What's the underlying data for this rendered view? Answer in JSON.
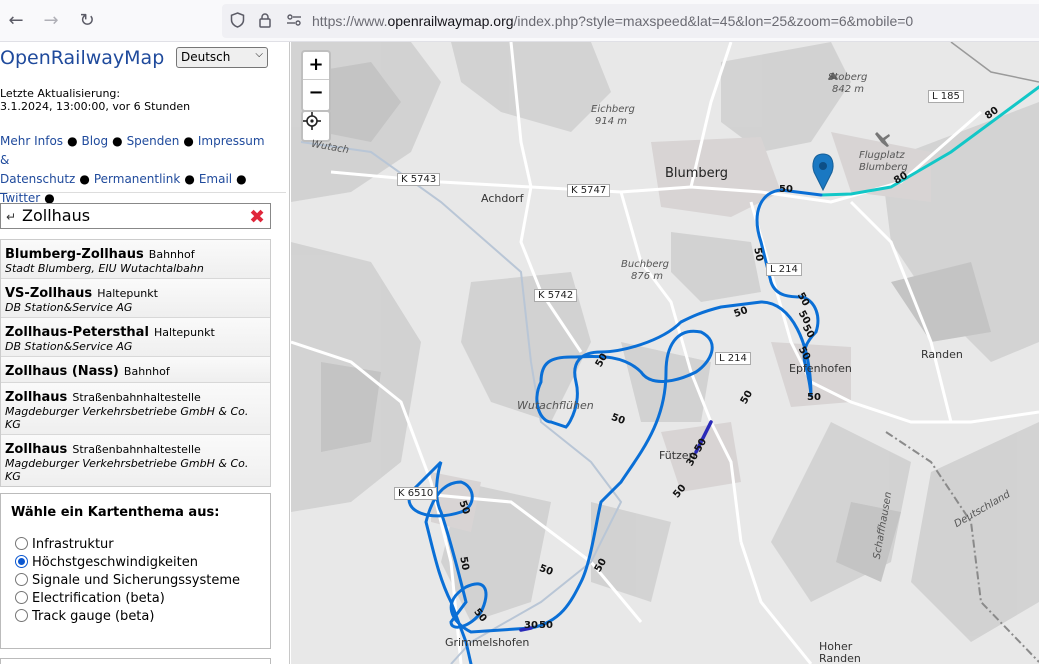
{
  "browser": {
    "url_prefix": "https://www.",
    "url_host": "openrailwaymap.org",
    "url_rest": "/index.php?style=maxspeed&lat=45&lon=25&zoom=6&mobile=0"
  },
  "sidebar": {
    "title": "OpenRailwayMap",
    "language": "Deutsch",
    "update_label": "Letzte Aktualisierung:",
    "update_value": "3.1.2024, 13:00:00, vor 6 Stunden",
    "links": {
      "more_info": "Mehr Infos",
      "blog": "Blog",
      "donate": "Spenden",
      "imprint": "Impressum &",
      "privacy": "Datenschutz",
      "permalink": "Permanentlink",
      "email": "Email",
      "twitter": "Twitter"
    },
    "search": {
      "value": "Zollhaus"
    },
    "results": [
      {
        "name": "Blumberg-Zollhaus",
        "type": "Bahnhof",
        "operator": "Stadt Blumberg, EIU Wutachtalbahn"
      },
      {
        "name": "VS-Zollhaus",
        "type": "Haltepunkt",
        "operator": "DB Station&Service AG"
      },
      {
        "name": "Zollhaus-Petersthal",
        "type": "Haltepunkt",
        "operator": "DB Station&Service AG"
      },
      {
        "name": "Zollhaus (Nass)",
        "type": "Bahnhof",
        "operator": ""
      },
      {
        "name": "Zollhaus",
        "type": "Straßenbahnhaltestelle",
        "operator": "Magdeburger Verkehrsbetriebe GmbH & Co. KG"
      },
      {
        "name": "Zollhaus",
        "type": "Straßenbahnhaltestelle",
        "operator": "Magdeburger Verkehrsbetriebe GmbH & Co. KG"
      }
    ],
    "theme": {
      "title": "Wähle ein Kartenthema aus:",
      "options": [
        {
          "label": "Infrastruktur",
          "checked": false
        },
        {
          "label": "Höchstgeschwindigkeiten",
          "checked": true
        },
        {
          "label": "Signale und Sicherungssysteme",
          "checked": false
        },
        {
          "label": "Electrification (beta)",
          "checked": false
        },
        {
          "label": "Track gauge (beta)",
          "checked": false
        }
      ]
    }
  },
  "map": {
    "zoom_in": "+",
    "zoom_out": "−",
    "places": {
      "blumberg": "Blumberg",
      "achdorf": "Achdorf",
      "randen": "Randen",
      "futzen": "Fützen",
      "epfenhofen": "Epfenhofen",
      "grimmelshofen": "Grimmelshofen",
      "wutachfluehen": "Wutachflühen",
      "eichberg": "Eichberg",
      "eichberg_elev": "914 m",
      "buchberg": "Buchberg",
      "buchberg_elev": "876 m",
      "stoberg": "Stoberg",
      "stoberg_elev": "842 m",
      "flugplatz": "Flugplatz",
      "flugplatz2": "Blumberg",
      "hoher_randen": "Hoher",
      "hoher_randen2": "Randen",
      "deutschland": "Deutschland",
      "schaffhausen": "Schaffhausen",
      "wutach": "Wutach"
    },
    "roads": [
      "K 5743",
      "K 5747",
      "K 5742",
      "L 214",
      "L 214",
      "L 185",
      "K 6510"
    ],
    "speeds": [
      "80",
      "80",
      "50",
      "50",
      "50",
      "50",
      "50",
      "50",
      "50",
      "50",
      "50",
      "50",
      "50",
      "30",
      "50",
      "50",
      "50",
      "50",
      "50",
      "50",
      "30",
      "50",
      "50"
    ],
    "colors": {
      "speed_50": "#0a6fd6",
      "speed_80": "#12c7c7",
      "speed_30": "#2a2ab8",
      "marker": "#1a78c2"
    }
  }
}
